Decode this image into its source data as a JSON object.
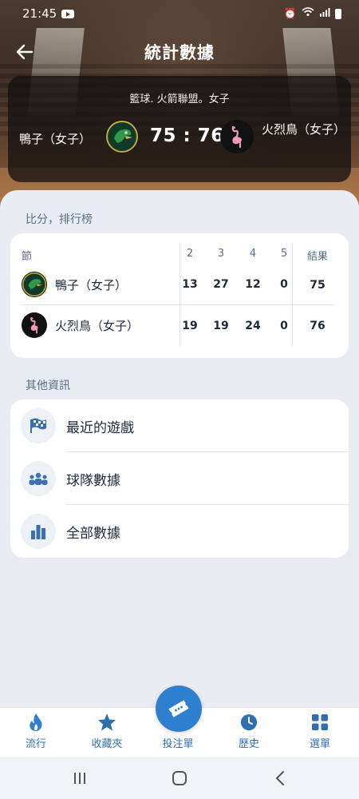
{
  "status_bar": {
    "time": "21:45"
  },
  "header": {
    "title": "統計數據",
    "league": "籃球. 火箭聯盟。女子",
    "home_team": "鴨子（女子）",
    "away_team": "火烈鳥（女子）",
    "score": "75 : 76"
  },
  "standings": {
    "section_title": "比分，排行榜",
    "columns": [
      "節",
      "2",
      "3",
      "4",
      "5",
      "結果"
    ],
    "rows": [
      {
        "team": "鴨子（女子）",
        "q2": "13",
        "q3": "27",
        "q4": "12",
        "q5": "0",
        "total": "75"
      },
      {
        "team": "火烈鳥（女子）",
        "q2": "19",
        "q3": "19",
        "q4": "24",
        "q5": "0",
        "total": "76"
      }
    ]
  },
  "other_info": {
    "section_title": "其他資訊",
    "items": [
      {
        "label": "最近的遊戲",
        "icon": "checkered-flag-icon"
      },
      {
        "label": "球隊數據",
        "icon": "team-icon"
      },
      {
        "label": "全部數據",
        "icon": "bar-chart-icon"
      }
    ]
  },
  "bottom_nav": {
    "items": [
      {
        "label": "流行",
        "icon": "flame-icon"
      },
      {
        "label": "收藏夾",
        "icon": "star-icon"
      },
      {
        "label": "投注單",
        "icon": "ticket-icon"
      },
      {
        "label": "歷史",
        "icon": "clock-icon"
      },
      {
        "label": "選單",
        "icon": "grid-menu-icon"
      }
    ]
  },
  "colors": {
    "accent": "#2f7fd0",
    "nav_label": "#2f6fb0",
    "sheet_bg": "#e9ecf2",
    "section_text": "#5a6c87"
  }
}
